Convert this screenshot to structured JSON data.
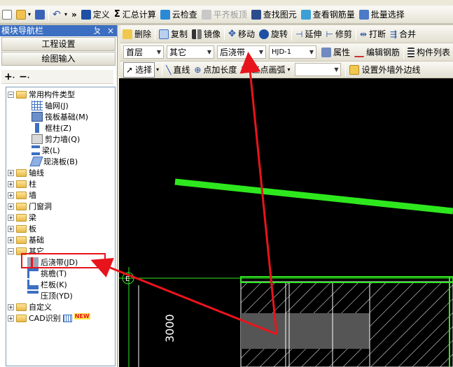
{
  "toolbar1": {
    "items": [
      "定义",
      "汇总计算",
      "云检查",
      "平齐板顶",
      "查找图元",
      "查看钢筋量",
      "批量选择"
    ],
    "overflow": "»"
  },
  "panel": {
    "title": "模块导航栏",
    "pin": "ㄆ",
    "close": "×",
    "btn_project": "工程设置",
    "btn_draw": "绘图输入"
  },
  "toolbar2": {
    "items": [
      "删除",
      "复制",
      "镜像",
      "移动",
      "旋转",
      "延伸",
      "修剪",
      "打断",
      "合并"
    ]
  },
  "toolbar3": {
    "floor": "首层",
    "category": "其它",
    "type": "后浇带",
    "member": "HJD-1",
    "attr": "属性",
    "edit_rebar": "编辑钢筋",
    "member_list": "构件列表"
  },
  "toolbar4": {
    "select": "选择",
    "line": "直线",
    "point_length": "点加长度",
    "arc": "三点画弧",
    "set_wall": "设置外墙外边线"
  },
  "tree": {
    "common_group": "常用构件类型",
    "common_items": [
      "轴网(J)",
      "筏板基础(M)",
      "框柱(Z)",
      "剪力墙(Q)",
      "梁(L)",
      "现浇板(B)"
    ],
    "groups": [
      "轴线",
      "柱",
      "墙",
      "门窗洞",
      "梁",
      "板",
      "基础",
      "其它"
    ],
    "other_items": [
      "后浇带(JD)",
      "挑檐(T)",
      "栏板(K)",
      "压顶(YD)"
    ],
    "tail_groups": [
      "自定义",
      "CAD识别"
    ],
    "new_badge": "NEW"
  },
  "canvas": {
    "axis_label": "3000",
    "axis_bubble": "E"
  },
  "colors": {
    "accent_red": "#e8141c",
    "green_line": "#2ee81e",
    "title_blue": "#3c6fc1",
    "selection_red": "#e8141c"
  }
}
